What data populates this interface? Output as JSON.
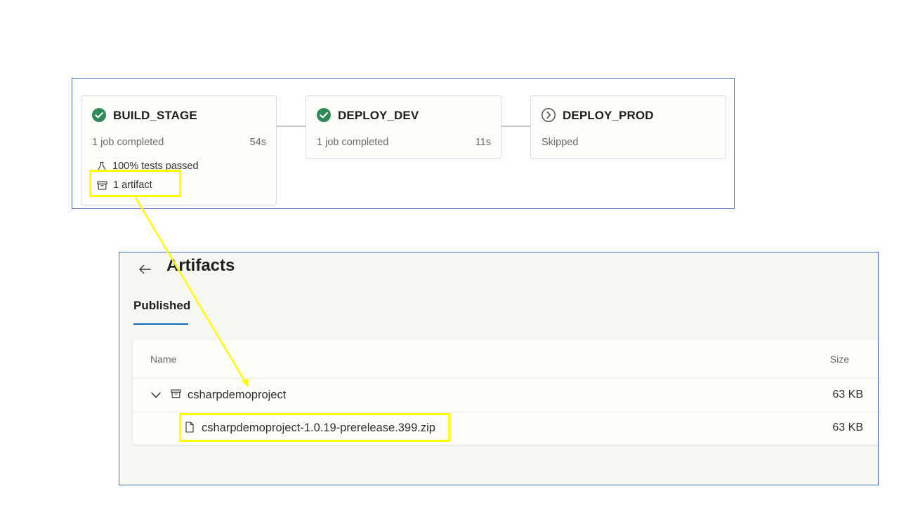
{
  "pipeline": {
    "stages": [
      {
        "name": "BUILD_STAGE",
        "status": "succeeded",
        "status_icon": "check-circle-icon",
        "subtitle": "1 job completed",
        "duration": "54s",
        "tests": "100% tests passed",
        "artifacts": "1 artifact"
      },
      {
        "name": "DEPLOY_DEV",
        "status": "succeeded",
        "status_icon": "check-circle-icon",
        "subtitle": "1 job completed",
        "duration": "11s"
      },
      {
        "name": "DEPLOY_PROD",
        "status": "skipped",
        "status_icon": "skipped-circle-icon",
        "subtitle": "Skipped"
      }
    ],
    "colors": {
      "success": "#2e8b57",
      "skipped": "#605e5c",
      "highlight": "#ffff00",
      "panel_border": "#4a6fb5"
    }
  },
  "artifacts": {
    "title": "Artifacts",
    "tab": "Published",
    "columns": {
      "name": "Name",
      "size": "Size"
    },
    "rows": [
      {
        "name": "csharpdemoproject",
        "size": "63 KB",
        "icon": "artifact-box-icon",
        "expanded": true
      },
      {
        "name": "csharpdemoproject-1.0.19-prerelease.399.zip",
        "size": "63 KB",
        "icon": "file-icon"
      }
    ],
    "colors": {
      "tab_underline": "#0f6cbd"
    }
  }
}
